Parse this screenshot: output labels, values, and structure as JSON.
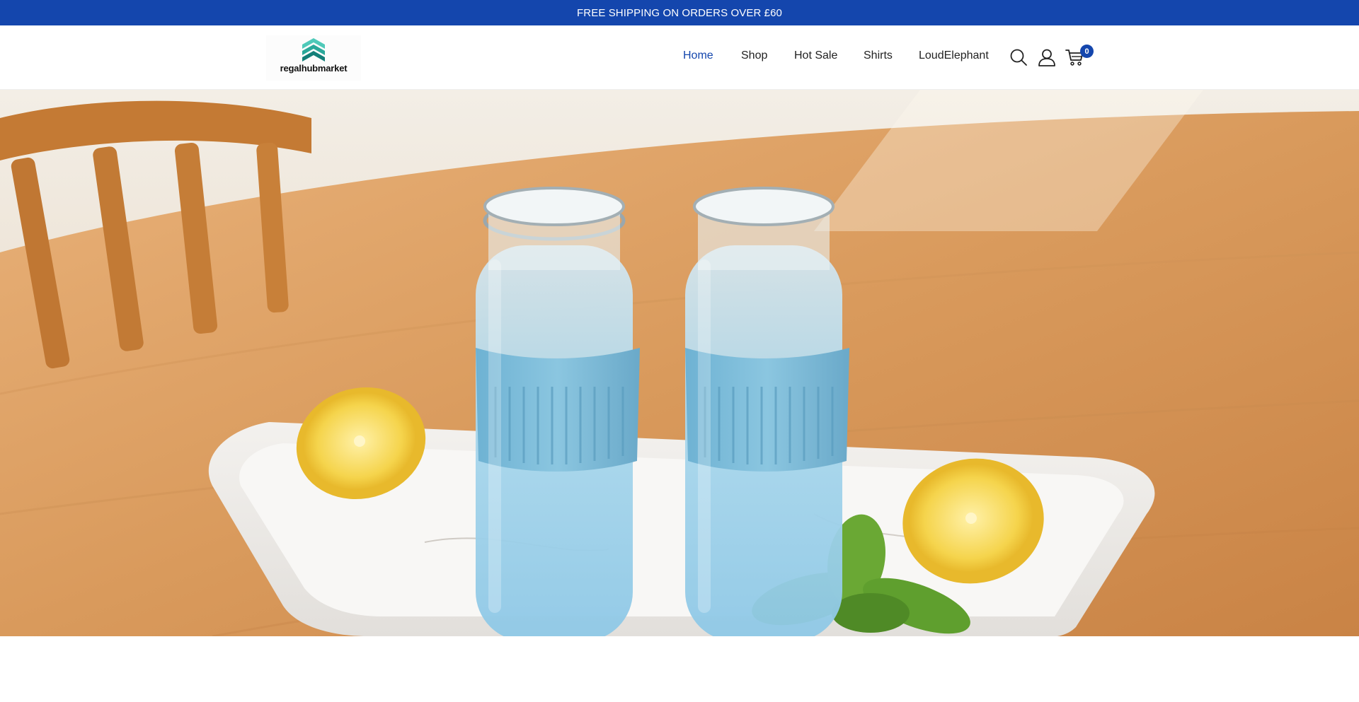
{
  "announcement": {
    "text": "FREE SHIPPING ON ORDERS OVER £60"
  },
  "brand": {
    "name": "regalhubmarket",
    "logo_icon": "stacked-chevron-logo-icon"
  },
  "nav": {
    "items": [
      {
        "label": "Home",
        "active": true
      },
      {
        "label": "Shop",
        "active": false
      },
      {
        "label": "Hot Sale",
        "active": false
      },
      {
        "label": "Shirts",
        "active": false
      },
      {
        "label": "LoudElephant",
        "active": false
      }
    ]
  },
  "header_icons": {
    "search": "search-icon",
    "account": "user-icon",
    "cart": "cart-icon",
    "cart_count": "0"
  },
  "hero": {
    "image": "photo of two frosted light-blue glass tumblers with silicone sleeves on a marble tray with lemon halves and mint on a wooden table"
  },
  "colors": {
    "brand_blue": "#1446ad",
    "text": "#222222"
  }
}
